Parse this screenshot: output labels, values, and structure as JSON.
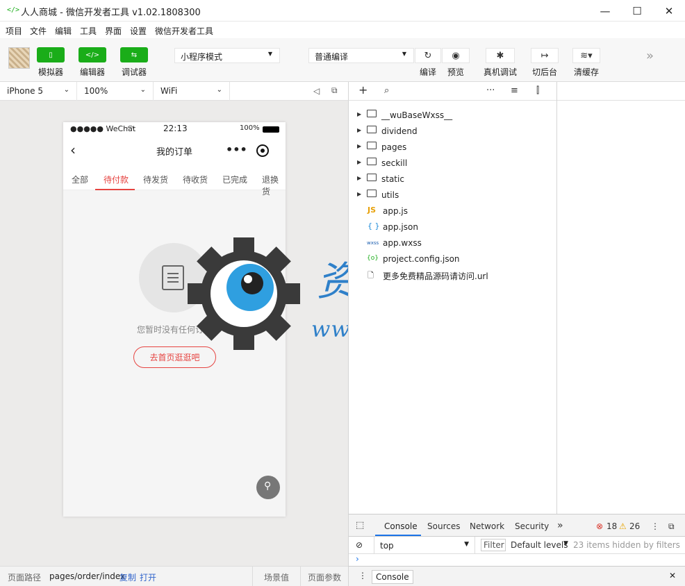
{
  "window": {
    "title": "人人商城 - 微信开发者工具 v1.02.1808300",
    "minimize": "—",
    "maximize": "☐",
    "close": "✕"
  },
  "menu": [
    "项目",
    "文件",
    "编辑",
    "工具",
    "界面",
    "设置",
    "微信开发者工具"
  ],
  "toolbar": {
    "simulator_label": "模拟器",
    "editor_label": "编辑器",
    "debugger_label": "调试器",
    "mode_select": "小程序模式",
    "compile_select": "普通编译",
    "compile_label": "编译",
    "preview_label": "预览",
    "remote_debug_label": "真机调试",
    "background_label": "切后台",
    "clear_cache_label": "清缓存",
    "more": "»"
  },
  "simulator": {
    "device": "iPhone 5",
    "zoom": "100%",
    "network": "WiFi"
  },
  "phone": {
    "carrier": "●●●●● WeChat",
    "time": "22:13",
    "battery": "100%",
    "page_title": "我的订单",
    "menu_dots": "•••",
    "tabs": [
      "全部",
      "待付款",
      "待发货",
      "待收货",
      "已完成",
      "退换货"
    ],
    "active_tab_index": 1,
    "empty_text": "您暂时没有任何订单",
    "home_button": "去首页逛逛吧"
  },
  "watermark": {
    "line1": "资源邦",
    "line2": "www.wazyb.com"
  },
  "filetree": [
    {
      "type": "folder",
      "name": "__wuBaseWxss__"
    },
    {
      "type": "folder",
      "name": "dividend"
    },
    {
      "type": "folder",
      "name": "pages"
    },
    {
      "type": "folder",
      "name": "seckill"
    },
    {
      "type": "folder",
      "name": "static"
    },
    {
      "type": "folder",
      "name": "utils"
    },
    {
      "type": "js",
      "name": "app.js",
      "icon": "JS"
    },
    {
      "type": "json",
      "name": "app.json",
      "icon": "{ }"
    },
    {
      "type": "wxss",
      "name": "app.wxss",
      "icon": "wxss"
    },
    {
      "type": "config",
      "name": "project.config.json",
      "icon": "{o}"
    },
    {
      "type": "file",
      "name": "更多免费精品源码请访问.url"
    }
  ],
  "console": {
    "tabs": [
      "Console",
      "Sources",
      "Network",
      "Security"
    ],
    "more": "»",
    "errors": "18",
    "warnings": "26",
    "context": "top",
    "filter_placeholder": "Filter",
    "levels": "Default levels",
    "hidden": "23 items hidden by filters",
    "prompt": "›",
    "drawer_tab": "Console"
  },
  "footer": {
    "path_label": "页面路径",
    "path": "pages/order/index",
    "copy": "复制",
    "open": "打开",
    "scene": "场景值",
    "params": "页面参数"
  },
  "colors": {
    "accent": "#1aad19",
    "order_red": "#e64340",
    "watermark_blue": "#2f80c9"
  }
}
